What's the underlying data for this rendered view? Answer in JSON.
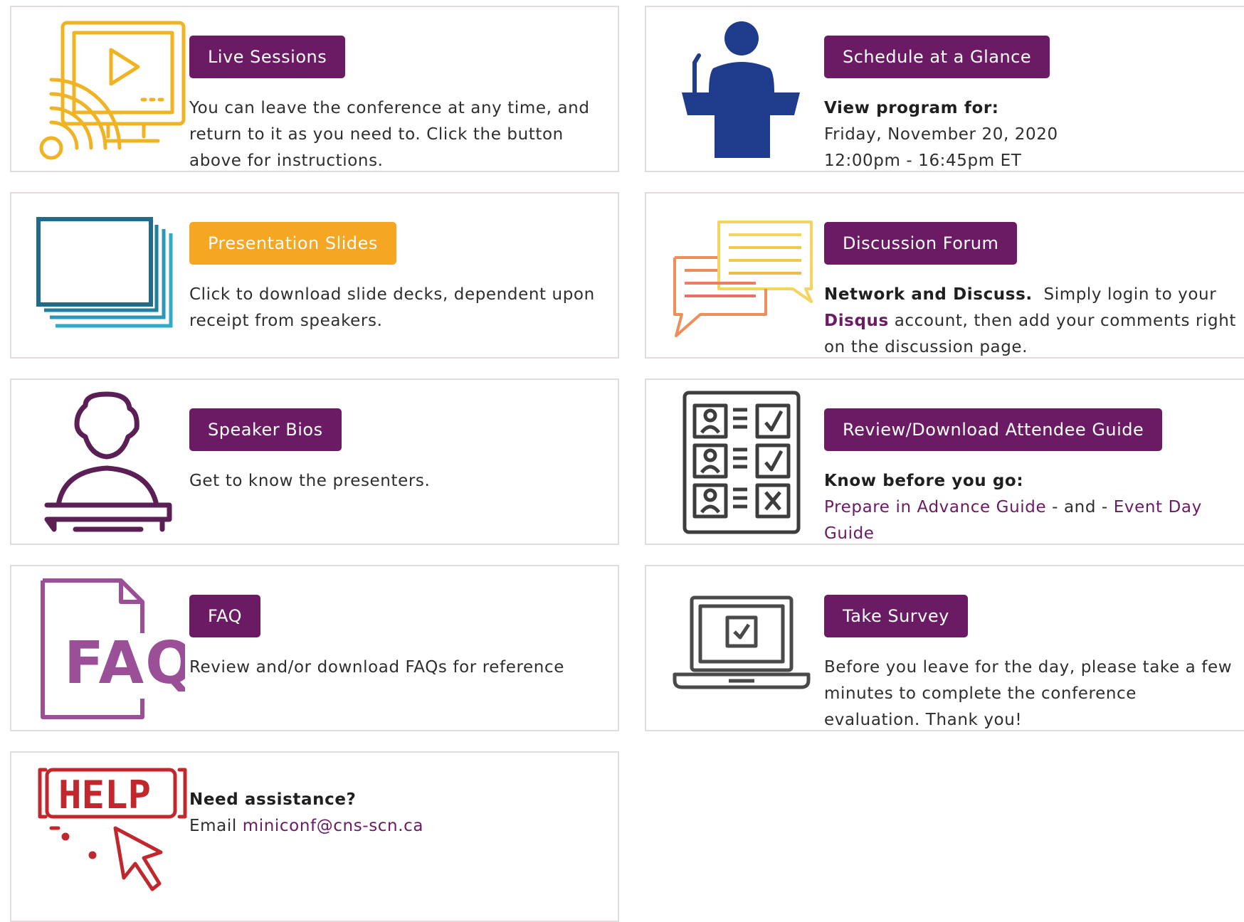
{
  "colors": {
    "button_purple": "#6a1b63",
    "button_orange": "#f5a623",
    "card_border": "#e2dcdc",
    "link_purple": "#6a1b63"
  },
  "cards": {
    "live_sessions": {
      "icon": "live-stream-monitor-icon",
      "button": "Live Sessions",
      "text": "You can leave the conference at any time, and return to it as you need to. Click the button above for instructions."
    },
    "schedule": {
      "icon": "speaker-podium-icon",
      "button": "Schedule at a Glance",
      "heading": "View program for:",
      "date": "Friday, November 20, 2020",
      "time": "12:00pm - 16:45pm ET"
    },
    "slides": {
      "icon": "slides-stack-icon",
      "button": "Presentation Slides",
      "text": "Click to download slide decks, dependent upon receipt from speakers."
    },
    "forum": {
      "icon": "chat-bubbles-icon",
      "button": "Discussion Forum",
      "bold_lead": "Network and Discuss.",
      "text_1": "Simply login to your",
      "link": "Disqus",
      "text_2": "account, then add your comments right on the discussion page."
    },
    "bios": {
      "icon": "presenter-icon",
      "button": "Speaker Bios",
      "text": "Get to know the presenters."
    },
    "guide": {
      "icon": "checklist-icon",
      "button": "Review/Download Attendee Guide",
      "heading": "Know before you go:",
      "link_1": "Prepare in Advance Guide",
      "separator": "- and -",
      "link_2": "Event Day Guide"
    },
    "faq": {
      "icon": "faq-document-icon",
      "button": "FAQ",
      "text": "Review and/or download FAQs for reference"
    },
    "survey": {
      "icon": "laptop-checkbox-icon",
      "button": "Take Survey",
      "text": "Before you leave for the day, please take a few minutes to complete the conference evaluation. Thank you!"
    },
    "help": {
      "icon": "help-cursor-icon",
      "heading": "Need assistance?",
      "email_label": "Email",
      "email": "miniconf@cns-scn.ca"
    }
  }
}
